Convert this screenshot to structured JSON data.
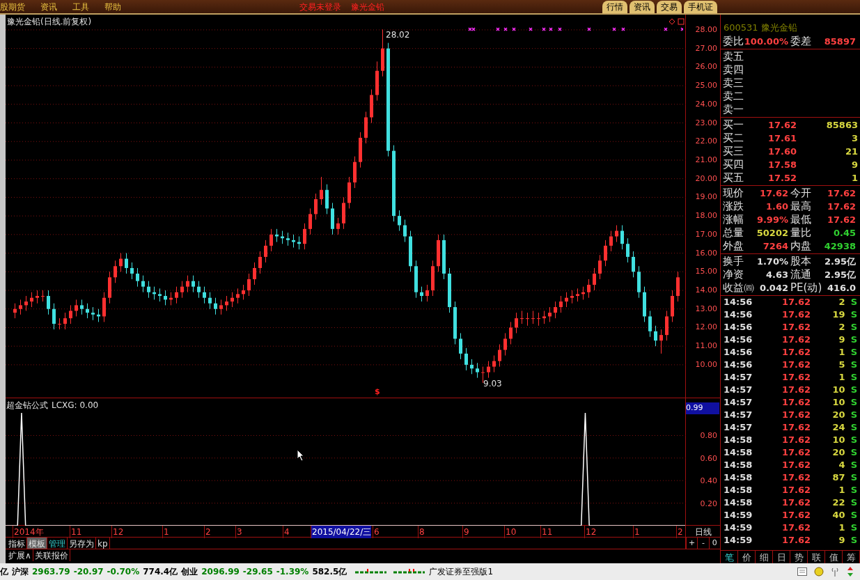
{
  "menu": {
    "items": [
      "股期货",
      "资讯",
      "工具",
      "帮助"
    ],
    "status": [
      "交易未登录",
      "豫光金铅"
    ],
    "tabs": [
      "行情",
      "资讯",
      "交易",
      "手机证"
    ]
  },
  "chart": {
    "title": "豫光金铅(日线.前复权)",
    "high_label": "28.02",
    "low_label": "9.03",
    "signal_mark": "$",
    "chart_data": {
      "type": "candlestick",
      "yticks": [
        {
          "value": 28,
          "label": "28.00"
        },
        {
          "value": 27,
          "label": "27.00"
        },
        {
          "value": 26,
          "label": "26.00"
        },
        {
          "value": 25,
          "label": "25.00"
        },
        {
          "value": 24,
          "label": "24.00"
        },
        {
          "value": 23,
          "label": "23.00"
        },
        {
          "value": 22,
          "label": "22.00"
        },
        {
          "value": 21,
          "label": "21.00"
        },
        {
          "value": 20,
          "label": "20.00"
        },
        {
          "value": 19,
          "label": "19.00"
        },
        {
          "value": 18,
          "label": "18.00"
        },
        {
          "value": 17,
          "label": "17.00"
        },
        {
          "value": 16,
          "label": "16.00"
        },
        {
          "value": 15,
          "label": "15.00"
        },
        {
          "value": 14,
          "label": "14.00"
        },
        {
          "value": 13,
          "label": "13.00"
        },
        {
          "value": 12,
          "label": "12.00"
        },
        {
          "value": 11,
          "label": "11.00"
        },
        {
          "value": 10,
          "label": "10.00"
        }
      ],
      "ylim": [
        8.2,
        28.82
      ],
      "grid": true,
      "ohlc": [
        [
          12.8,
          13.3,
          12.5,
          13.0
        ],
        [
          13.0,
          13.5,
          12.7,
          13.2
        ],
        [
          13.2,
          13.7,
          12.9,
          13.4
        ],
        [
          13.4,
          13.9,
          13.1,
          13.6
        ],
        [
          13.6,
          14.0,
          13.3,
          13.7
        ],
        [
          13.7,
          14.0,
          13.4,
          13.7
        ],
        [
          13.7,
          14.0,
          12.7,
          13.0
        ],
        [
          13.0,
          13.3,
          11.9,
          12.2
        ],
        [
          12.2,
          12.5,
          11.9,
          12.2
        ],
        [
          12.2,
          12.8,
          11.9,
          12.5
        ],
        [
          12.5,
          13.2,
          12.2,
          12.9
        ],
        [
          12.9,
          13.5,
          12.6,
          13.2
        ],
        [
          13.2,
          13.5,
          12.7,
          13.0
        ],
        [
          13.0,
          13.3,
          12.5,
          12.8
        ],
        [
          12.8,
          13.1,
          12.4,
          12.7
        ],
        [
          12.7,
          13.0,
          12.3,
          12.6
        ],
        [
          12.6,
          13.9,
          12.3,
          13.6
        ],
        [
          13.6,
          15.0,
          13.3,
          14.7
        ],
        [
          14.7,
          15.6,
          14.4,
          15.3
        ],
        [
          15.3,
          16.0,
          15.0,
          15.7
        ],
        [
          15.7,
          16.0,
          14.9,
          15.2
        ],
        [
          15.2,
          15.5,
          14.6,
          14.9
        ],
        [
          14.9,
          15.2,
          14.2,
          14.5
        ],
        [
          14.5,
          14.8,
          13.9,
          14.2
        ],
        [
          14.2,
          14.5,
          13.6,
          13.9
        ],
        [
          13.9,
          14.2,
          13.5,
          13.8
        ],
        [
          13.8,
          14.1,
          13.4,
          13.7
        ],
        [
          13.7,
          14.0,
          13.2,
          13.5
        ],
        [
          13.5,
          13.9,
          13.2,
          13.6
        ],
        [
          13.6,
          14.2,
          13.3,
          13.9
        ],
        [
          13.9,
          14.5,
          13.6,
          14.2
        ],
        [
          14.2,
          14.8,
          13.9,
          14.5
        ],
        [
          14.5,
          14.8,
          13.9,
          14.2
        ],
        [
          14.2,
          14.5,
          13.6,
          13.9
        ],
        [
          13.9,
          14.2,
          13.3,
          13.6
        ],
        [
          13.6,
          13.9,
          13.0,
          13.3
        ],
        [
          13.3,
          13.6,
          12.7,
          13.0
        ],
        [
          13.0,
          13.5,
          12.7,
          13.2
        ],
        [
          13.2,
          13.7,
          12.9,
          13.4
        ],
        [
          13.4,
          13.9,
          13.1,
          13.6
        ],
        [
          13.6,
          14.1,
          13.3,
          13.8
        ],
        [
          13.8,
          14.3,
          13.5,
          14.0
        ],
        [
          14.0,
          14.9,
          13.7,
          14.6
        ],
        [
          14.6,
          15.5,
          14.3,
          15.2
        ],
        [
          15.2,
          16.1,
          14.9,
          15.8
        ],
        [
          15.8,
          16.7,
          15.5,
          16.4
        ],
        [
          16.4,
          17.3,
          16.1,
          17.0
        ],
        [
          17.0,
          17.3,
          16.6,
          16.9
        ],
        [
          16.9,
          17.2,
          16.5,
          16.8
        ],
        [
          16.8,
          17.1,
          16.4,
          16.7
        ],
        [
          16.7,
          17.0,
          16.3,
          16.6
        ],
        [
          16.6,
          16.9,
          16.2,
          16.5
        ],
        [
          16.5,
          17.6,
          16.2,
          17.3
        ],
        [
          17.3,
          18.4,
          17.0,
          18.1
        ],
        [
          18.1,
          19.2,
          17.8,
          18.9
        ],
        [
          18.9,
          20.1,
          18.6,
          19.4
        ],
        [
          19.4,
          19.7,
          18.1,
          18.4
        ],
        [
          18.4,
          18.7,
          17.0,
          17.3
        ],
        [
          17.3,
          17.9,
          17.0,
          17.6
        ],
        [
          17.6,
          19.0,
          17.3,
          18.7
        ],
        [
          18.7,
          20.1,
          18.4,
          19.8
        ],
        [
          19.8,
          21.2,
          19.5,
          20.9
        ],
        [
          20.9,
          22.5,
          20.6,
          22.2
        ],
        [
          22.2,
          23.6,
          21.9,
          23.3
        ],
        [
          23.3,
          24.8,
          23.0,
          24.5
        ],
        [
          24.5,
          26.3,
          24.2,
          25.8
        ],
        [
          25.8,
          28.02,
          25.5,
          27.0
        ],
        [
          27.0,
          27.3,
          21.2,
          21.5
        ],
        [
          21.5,
          21.8,
          17.7,
          18.0
        ],
        [
          18.0,
          18.3,
          17.2,
          17.5
        ],
        [
          17.5,
          17.8,
          16.6,
          16.9
        ],
        [
          16.9,
          17.2,
          15.0,
          15.3
        ],
        [
          15.3,
          15.6,
          13.6,
          13.9
        ],
        [
          13.9,
          14.2,
          13.4,
          13.7
        ],
        [
          13.7,
          14.3,
          13.4,
          14.0
        ],
        [
          14.0,
          15.6,
          13.7,
          15.3
        ],
        [
          15.3,
          17.0,
          15.0,
          16.7
        ],
        [
          16.7,
          17.0,
          14.6,
          14.9
        ],
        [
          14.9,
          15.2,
          12.8,
          13.1
        ],
        [
          13.1,
          13.4,
          11.1,
          11.4
        ],
        [
          11.4,
          11.7,
          10.3,
          10.6
        ],
        [
          10.6,
          10.9,
          9.7,
          10.0
        ],
        [
          10.0,
          10.3,
          9.5,
          9.8
        ],
        [
          9.8,
          10.1,
          9.3,
          9.6
        ],
        [
          9.6,
          9.9,
          9.03,
          9.6
        ],
        [
          9.6,
          10.2,
          9.3,
          9.9
        ],
        [
          9.9,
          10.5,
          9.6,
          10.2
        ],
        [
          10.2,
          11.1,
          9.9,
          10.8
        ],
        [
          10.8,
          11.7,
          10.5,
          11.4
        ],
        [
          11.4,
          12.3,
          11.1,
          12.0
        ],
        [
          12.0,
          12.8,
          11.7,
          12.5
        ],
        [
          12.5,
          12.9,
          12.2,
          12.5
        ],
        [
          12.5,
          12.8,
          12.1,
          12.5
        ],
        [
          12.5,
          12.9,
          12.2,
          12.5
        ],
        [
          12.5,
          12.8,
          12.1,
          12.5
        ],
        [
          12.5,
          12.9,
          12.2,
          12.6
        ],
        [
          12.6,
          13.1,
          12.3,
          12.8
        ],
        [
          12.8,
          13.4,
          12.5,
          13.1
        ],
        [
          13.1,
          13.7,
          12.8,
          13.4
        ],
        [
          13.4,
          13.9,
          13.1,
          13.6
        ],
        [
          13.6,
          14.0,
          13.3,
          13.7
        ],
        [
          13.7,
          14.1,
          13.4,
          13.8
        ],
        [
          13.8,
          14.2,
          13.5,
          13.9
        ],
        [
          13.9,
          14.6,
          13.6,
          14.3
        ],
        [
          14.3,
          15.2,
          14.0,
          14.9
        ],
        [
          14.9,
          15.9,
          14.6,
          15.6
        ],
        [
          15.6,
          16.7,
          15.3,
          16.4
        ],
        [
          16.4,
          17.2,
          16.1,
          16.9
        ],
        [
          16.9,
          17.5,
          16.6,
          17.2
        ],
        [
          17.2,
          17.5,
          16.2,
          16.5
        ],
        [
          16.5,
          16.8,
          15.5,
          15.8
        ],
        [
          15.8,
          16.1,
          14.7,
          15.0
        ],
        [
          15.0,
          15.3,
          13.6,
          13.9
        ],
        [
          13.9,
          14.2,
          12.3,
          12.6
        ],
        [
          12.6,
          12.9,
          11.5,
          11.8
        ],
        [
          11.8,
          12.1,
          11.0,
          11.3
        ],
        [
          11.3,
          11.9,
          10.6,
          11.6
        ],
        [
          11.6,
          12.9,
          11.3,
          12.6
        ],
        [
          12.6,
          14.0,
          12.3,
          13.7
        ],
        [
          13.7,
          15.0,
          13.4,
          14.7
        ]
      ]
    }
  },
  "indicator": {
    "title": "超金钻公式",
    "reading": ": 0.00",
    "cursor_value": "0.99",
    "chart_data": {
      "type": "line",
      "ylim": [
        0,
        1.13
      ],
      "grid": true,
      "yticks": [
        {
          "value": 0.2,
          "label": "0.20"
        },
        {
          "value": 0.4,
          "label": "0.40"
        },
        {
          "value": 0.6,
          "label": "0.60"
        },
        {
          "value": 0.8,
          "label": "0.80"
        }
      ],
      "series": [
        {
          "name": "LCXG",
          "color": "#ffffff",
          "values": [
            0,
            0,
            0,
            0,
            1,
            0,
            0,
            0,
            0,
            0,
            0,
            0,
            0,
            0,
            0,
            0,
            0,
            0,
            0,
            0,
            0,
            0,
            0,
            0,
            0,
            0,
            0,
            0,
            0,
            0,
            0,
            0,
            0,
            0,
            0,
            0,
            0,
            0,
            0,
            0,
            0,
            0,
            0,
            0,
            0,
            0,
            0,
            0,
            0,
            0,
            0,
            0,
            0,
            0,
            0,
            0,
            0,
            0,
            0,
            0,
            0,
            0,
            0,
            0,
            0,
            0,
            0,
            0,
            0,
            0,
            0,
            0,
            0,
            0,
            0,
            0,
            0,
            0,
            0,
            0,
            0,
            0,
            0,
            0,
            0,
            0,
            0,
            0,
            0,
            0,
            0,
            0,
            0,
            0,
            0,
            0,
            0,
            0,
            0,
            0,
            0,
            0,
            0,
            0,
            0,
            0,
            0,
            0,
            0,
            0,
            0,
            0,
            0,
            0,
            0,
            0,
            0,
            0,
            0,
            0,
            0,
            0,
            0,
            0,
            0,
            0,
            0,
            0,
            0,
            0,
            0,
            0,
            0,
            0,
            0,
            0,
            0,
            0,
            0,
            0,
            0,
            0,
            0,
            0,
            0,
            1,
            0,
            0,
            0,
            0,
            0,
            0,
            0,
            0,
            0,
            0,
            0,
            0,
            0,
            0,
            0,
            0,
            0,
            0,
            0,
            0,
            0,
            0,
            0,
            0,
            0
          ]
        }
      ]
    }
  },
  "date_axis": {
    "period": "日线",
    "labels": [
      {
        "label": "2014年",
        "selected": false
      },
      {
        "label": "11",
        "selected": false
      },
      {
        "label": "12",
        "selected": false
      },
      {
        "label": "1",
        "selected": false
      },
      {
        "label": "2",
        "selected": false
      },
      {
        "label": "3",
        "selected": false
      },
      {
        "label": "4",
        "selected": false
      },
      {
        "label": "2015/04/22/三",
        "selected": true
      },
      {
        "label": "6",
        "selected": false
      },
      {
        "label": "8",
        "selected": false
      },
      {
        "label": "9",
        "selected": false
      },
      {
        "label": "10",
        "selected": false
      },
      {
        "label": "11",
        "selected": false
      },
      {
        "label": "12",
        "selected": false
      },
      {
        "label": "1",
        "selected": false
      },
      {
        "label": "2",
        "selected": false
      }
    ]
  },
  "toolbar": {
    "tabs": [
      {
        "label": "指标",
        "selected": false,
        "kind": "tab"
      },
      {
        "label": "模板",
        "selected": true,
        "kind": "tab"
      },
      {
        "label": "管理",
        "selected": false,
        "kind": "link"
      },
      {
        "label": "另存为",
        "selected": false,
        "kind": "tab"
      },
      {
        "label": "kp",
        "selected": false,
        "kind": "tab"
      }
    ],
    "zoom_buttons": [
      "+",
      "-",
      "0"
    ]
  },
  "sub_tabs": [
    "扩展∧",
    "关联报价"
  ],
  "quote": {
    "header": "600531 豫光金铅",
    "sections": [
      [
        {
          "kind": "pair",
          "cells": [
            {
              "label": "委比",
              "value": "100.00%",
              "color": "#ff4040"
            },
            {
              "label": "委差",
              "value": "85897",
              "color": "#ff4040"
            }
          ]
        }
      ],
      [
        {
          "kind": "label",
          "label": "卖五"
        },
        {
          "kind": "label",
          "label": "卖四"
        },
        {
          "kind": "label",
          "label": "卖三"
        },
        {
          "kind": "label",
          "label": "卖二"
        },
        {
          "kind": "label",
          "label": "卖一"
        }
      ],
      [
        {
          "kind": "order",
          "label": "买一",
          "price": "17.62",
          "volume": "85863"
        },
        {
          "kind": "order",
          "label": "买二",
          "price": "17.61",
          "volume": "3"
        },
        {
          "kind": "order",
          "label": "买三",
          "price": "17.60",
          "volume": "21"
        },
        {
          "kind": "order",
          "label": "买四",
          "price": "17.58",
          "volume": "9"
        },
        {
          "kind": "order",
          "label": "买五",
          "price": "17.52",
          "volume": "1"
        }
      ],
      [
        {
          "kind": "pair",
          "cells": [
            {
              "label": "现价",
              "value": "17.62",
              "color": "#ff4040"
            },
            {
              "label": "今开",
              "value": "17.62",
              "color": "#ff4040"
            }
          ]
        },
        {
          "kind": "pair",
          "cells": [
            {
              "label": "涨跌",
              "value": "1.60",
              "color": "#ff4040"
            },
            {
              "label": "最高",
              "value": "17.62",
              "color": "#ff4040"
            }
          ]
        },
        {
          "kind": "pair",
          "cells": [
            {
              "label": "涨幅",
              "value": "9.99%",
              "color": "#ff4040"
            },
            {
              "label": "最低",
              "value": "17.62",
              "color": "#ff4040"
            }
          ]
        },
        {
          "kind": "pair",
          "cells": [
            {
              "label": "总量",
              "value": "50202",
              "color": "#d8d840"
            },
            {
              "label": "量比",
              "value": "0.45",
              "color": "#30d030"
            }
          ]
        },
        {
          "kind": "pair",
          "cells": [
            {
              "label": "外盘",
              "value": "7264",
              "color": "#ff4040"
            },
            {
              "label": "内盘",
              "value": "42938",
              "color": "#30d030"
            }
          ]
        }
      ],
      [
        {
          "kind": "pair",
          "cells": [
            {
              "label": "换手",
              "value": "1.70%",
              "color": "#e0e0e0"
            },
            {
              "label": "股本",
              "value": "2.95亿",
              "color": "#e0e0e0"
            }
          ]
        },
        {
          "kind": "pair",
          "cells": [
            {
              "label": "净资",
              "value": "4.63",
              "color": "#e0e0e0"
            },
            {
              "label": "流通",
              "value": "2.95亿",
              "color": "#e0e0e0"
            }
          ]
        },
        {
          "kind": "pair",
          "cells": [
            {
              "label": "收益㈣",
              "value": "0.042",
              "color": "#e0e0e0"
            },
            {
              "label": "PE(动)",
              "value": "416.0",
              "color": "#e0e0e0"
            }
          ]
        }
      ]
    ]
  },
  "trades": [
    {
      "time": "14:56",
      "price": "17.62",
      "volume": "2",
      "side": "S"
    },
    {
      "time": "14:56",
      "price": "17.62",
      "volume": "19",
      "side": "S"
    },
    {
      "time": "14:56",
      "price": "17.62",
      "volume": "2",
      "side": "S"
    },
    {
      "time": "14:56",
      "price": "17.62",
      "volume": "9",
      "side": "S"
    },
    {
      "time": "14:56",
      "price": "17.62",
      "volume": "1",
      "side": "S"
    },
    {
      "time": "14:56",
      "price": "17.62",
      "volume": "5",
      "side": "S"
    },
    {
      "time": "14:57",
      "price": "17.62",
      "volume": "1",
      "side": "S"
    },
    {
      "time": "14:57",
      "price": "17.62",
      "volume": "10",
      "side": "S"
    },
    {
      "time": "14:57",
      "price": "17.62",
      "volume": "10",
      "side": "S"
    },
    {
      "time": "14:57",
      "price": "17.62",
      "volume": "20",
      "side": "S"
    },
    {
      "time": "14:57",
      "price": "17.62",
      "volume": "24",
      "side": "S"
    },
    {
      "time": "14:58",
      "price": "17.62",
      "volume": "10",
      "side": "S"
    },
    {
      "time": "14:58",
      "price": "17.62",
      "volume": "20",
      "side": "S"
    },
    {
      "time": "14:58",
      "price": "17.62",
      "volume": "4",
      "side": "S"
    },
    {
      "time": "14:58",
      "price": "17.62",
      "volume": "87",
      "side": "S"
    },
    {
      "time": "14:58",
      "price": "17.62",
      "volume": "1",
      "side": "S"
    },
    {
      "time": "14:58",
      "price": "17.62",
      "volume": "22",
      "side": "S"
    },
    {
      "time": "14:59",
      "price": "17.62",
      "volume": "40",
      "side": "S"
    },
    {
      "time": "14:59",
      "price": "17.62",
      "volume": "1",
      "side": "S"
    },
    {
      "time": "14:59",
      "price": "17.62",
      "volume": "9",
      "side": "S"
    }
  ],
  "panel_tabs": [
    {
      "label": "笔",
      "selected": true
    },
    {
      "label": "价",
      "selected": false
    },
    {
      "label": "细",
      "selected": false
    },
    {
      "label": "日",
      "selected": false
    },
    {
      "label": "势",
      "selected": false
    },
    {
      "label": "联",
      "selected": false
    },
    {
      "label": "值",
      "selected": false
    },
    {
      "label": "筹",
      "selected": false
    }
  ],
  "status_bar": {
    "items": [
      {
        "text": "亿",
        "color": "#000000"
      },
      {
        "text": "沪深",
        "color": "#000000"
      },
      {
        "text": "2963.79",
        "color": "#008000"
      },
      {
        "text": "-20.97",
        "color": "#008000"
      },
      {
        "text": "-0.70%",
        "color": "#008000"
      },
      {
        "text": "774.4亿",
        "color": "#000000"
      },
      {
        "text": "创业",
        "color": "#000000"
      },
      {
        "text": "2096.99",
        "color": "#008000"
      },
      {
        "text": "-29.65",
        "color": "#008000"
      },
      {
        "text": "-1.39%",
        "color": "#008000"
      },
      {
        "text": "582.5亿",
        "color": "#000000"
      }
    ],
    "broker": "广发证券至强版1"
  }
}
